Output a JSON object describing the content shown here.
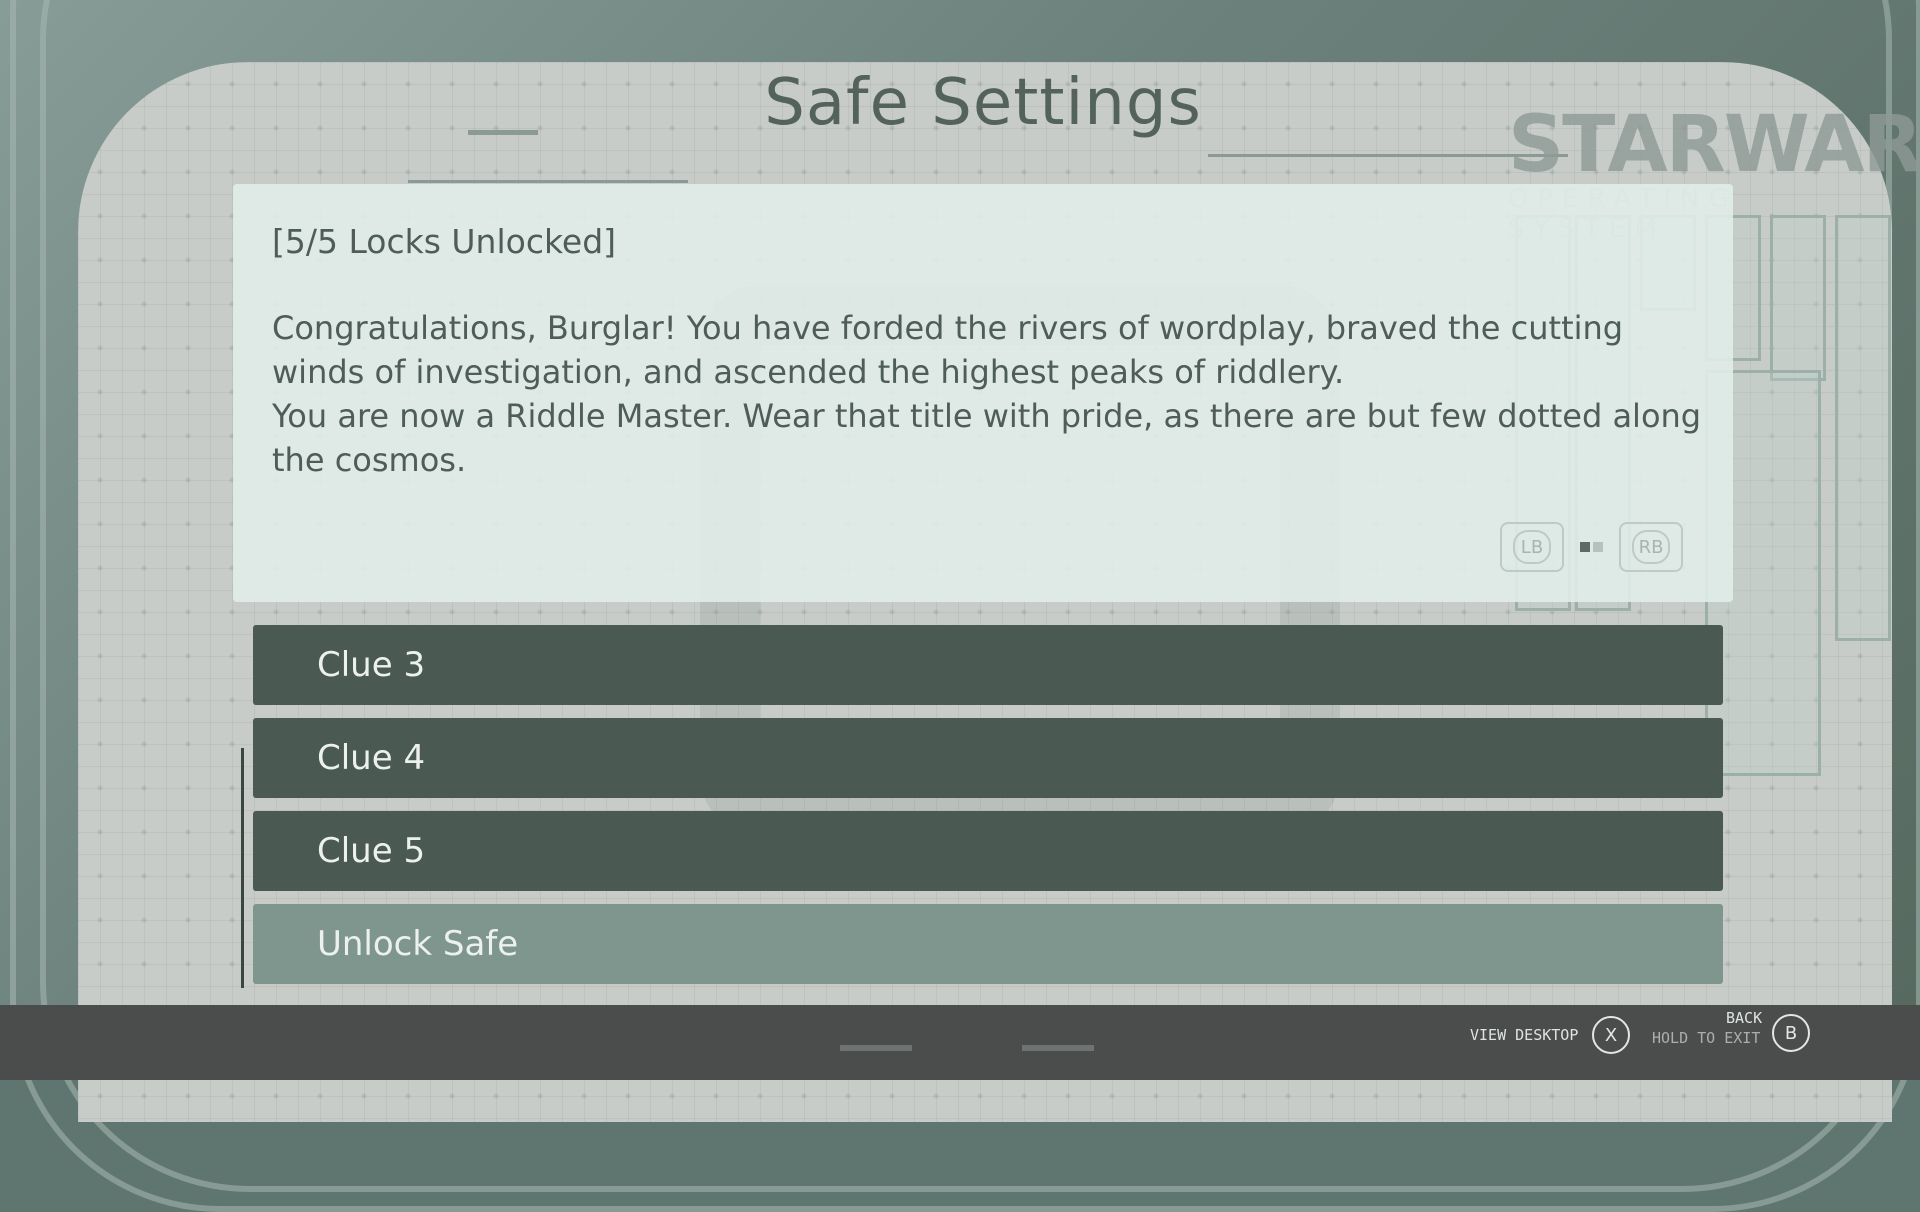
{
  "title": "Safe Settings",
  "brand": {
    "name": "STARWARE",
    "subtitle": "OPERATING SYSTEM"
  },
  "panel": {
    "status": "[5/5 Locks Unlocked]",
    "message": "Congratulations, Burglar! You have forded the rivers of wordplay, braved the cutting winds of investigation, and ascended the highest peaks of riddlery.\nYou are now a Riddle Master. Wear that title with pride, as there are but few dotted along the cosmos.",
    "pager": {
      "prev": "LB",
      "next": "RB",
      "page_count": 2,
      "current_page": 1
    }
  },
  "menu": {
    "items": [
      {
        "label": "Clue 3",
        "selected": false
      },
      {
        "label": "Clue 4",
        "selected": false
      },
      {
        "label": "Clue 5",
        "selected": false
      },
      {
        "label": "Unlock Safe",
        "selected": true
      }
    ]
  },
  "footer": {
    "view_desktop": {
      "label": "VIEW DESKTOP",
      "key": "X"
    },
    "back": {
      "label": "BACK",
      "sublabel": "HOLD TO EXIT",
      "key": "B"
    }
  },
  "colors": {
    "item_bg": "#4b5953",
    "item_selected_bg": "#7f968e",
    "panel_bg": "#e1eee9",
    "text": "#4e5d58"
  }
}
